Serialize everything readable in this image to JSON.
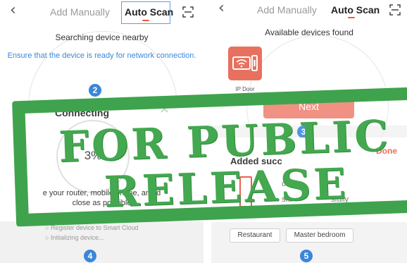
{
  "left": {
    "back_icon": "back-arrow-icon",
    "tabs": [
      "Add Manually",
      "Auto Scan"
    ],
    "active_tab": "Auto Scan",
    "scan_icon": "scan-frame-icon",
    "searching_title": "Searching device nearby",
    "searching_hint": "Ensure that the device is ready for network connection.",
    "step_top": "2",
    "connecting_title": "Connecting",
    "close_icon": "close-icon",
    "progress_percent": "3%",
    "router_hint_line1": "e your router, mobile phone, and d",
    "router_hint_line2": "close as possible",
    "status_items": [
      "Register device to Smart Cloud",
      "Initializing device..."
    ],
    "step_bottom": "4"
  },
  "right": {
    "back_icon": "back-arrow-icon",
    "tabs": [
      "Add Manually",
      "Auto Scan"
    ],
    "active_tab": "Auto Scan",
    "scan_icon": "scan-frame-icon",
    "found_title": "Available devices found",
    "device_icon": "video-doorbell-icon",
    "device_label": "IP Door",
    "next_label": "Next",
    "step_mid": "3",
    "done_label": "Done",
    "added_text": "Added succ",
    "partial_line1": "oo",
    "partial_line2": "sfu",
    "partial_line3": "sfully",
    "rooms": [
      "Restaurant",
      "Master bedroom"
    ],
    "step_bottom": "5"
  },
  "watermark": {
    "line1": "FOR PUBLIC",
    "line2": "RELEASE",
    "color": "#3fa34d"
  },
  "colors": {
    "accent": "#ef5a40",
    "step_badge": "#3b86d9",
    "hint_blue": "#3b86d9",
    "next_button": "#ef8272"
  }
}
